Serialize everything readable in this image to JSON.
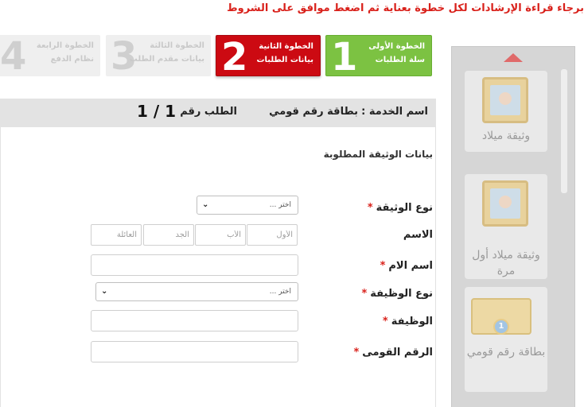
{
  "instruction": "برجاء قراءة الإرشادات لكل خطوة بعناية ثم اضغط موافق على الشروط",
  "steps": [
    {
      "number": "1",
      "line1": "الخطوة الأولى",
      "line2": "سلة الطلبات",
      "state": "done",
      "color": "#7cc242"
    },
    {
      "number": "2",
      "line1": "الخطوة الثانية",
      "line2": "بيانات الطلبات",
      "state": "active",
      "color": "#cc0a12"
    },
    {
      "number": "3",
      "line1": "الخطوة الثالثة",
      "line2": "بيانات مقدم الطلب",
      "state": "disabled"
    },
    {
      "number": "4",
      "line1": "الخطوة الرابعة",
      "line2": "نظام الدفع",
      "state": "disabled"
    }
  ],
  "service": {
    "label": "اسم الخدمة",
    "separator": ":",
    "value": "بطاقة رقم قومي",
    "request_label": "الطلب رقم",
    "request_number": "1 / 1"
  },
  "form": {
    "section_title": "بيانات الوثيقة المطلوبة",
    "doc_type": {
      "label": "نوع الوثيقة",
      "required_mark": "*",
      "selected": "اختر ...",
      "icon": "chevron-down-icon"
    },
    "name": {
      "label": "الاسم",
      "parts": [
        {
          "placeholder": "الأول"
        },
        {
          "placeholder": "الأب"
        },
        {
          "placeholder": "الجد"
        },
        {
          "placeholder": "العائلة"
        }
      ]
    },
    "mother_name": {
      "label": "اسم الام",
      "required_mark": "*",
      "value": ""
    },
    "job_type": {
      "label": "نوع الوظيفة",
      "required_mark": "*",
      "selected": "اختر ..."
    },
    "job": {
      "label": "الوظيفة",
      "required_mark": "*",
      "value": ""
    },
    "national_id": {
      "label": "الرقم القومى",
      "required_mark": "*",
      "value": ""
    }
  },
  "sidebar": {
    "cards": [
      {
        "label": "وثيقة ميلاد",
        "icon": "picture-frame-icon"
      },
      {
        "label": "وثيقة ميلاد أول مرة",
        "icon": "picture-frame-icon"
      },
      {
        "label": "بطاقة رقم قومي",
        "icon": "id-card-icon",
        "badge": "1"
      }
    ]
  },
  "colors": {
    "accent_red": "#d9211b",
    "step_done": "#7cc242",
    "step_active": "#cc0a12"
  }
}
